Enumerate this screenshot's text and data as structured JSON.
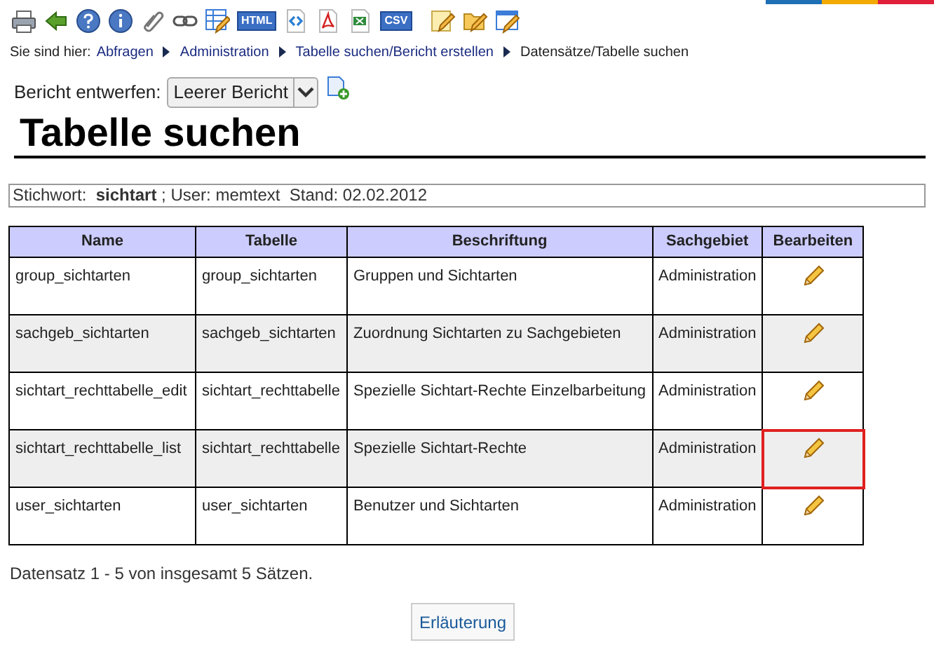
{
  "toolbar": [
    {
      "kind": "printer"
    },
    {
      "kind": "back"
    },
    {
      "kind": "help"
    },
    {
      "kind": "info"
    },
    {
      "kind": "clip"
    },
    {
      "kind": "link"
    },
    {
      "kind": "table-edit"
    },
    {
      "kind": "badge",
      "label": "HTML"
    },
    {
      "kind": "code"
    },
    {
      "kind": "pdf"
    },
    {
      "kind": "excel"
    },
    {
      "kind": "badge",
      "label": "CSV"
    },
    {
      "kind": "note-edit"
    },
    {
      "kind": "folder-edit"
    },
    {
      "kind": "window-edit"
    }
  ],
  "breadcrumb": {
    "label": "Sie sind hier:",
    "links": [
      "Abfragen",
      "Administration",
      "Tabelle suchen/Bericht erstellen"
    ],
    "current": "Datensätze/Tabelle suchen"
  },
  "report": {
    "label": "Bericht entwerfen:",
    "value": "Leerer Bericht"
  },
  "title": "Tabelle suchen",
  "info": "Stichwort:  **sichtart** ; User: memtext  Stand: 02.02.2012",
  "table": {
    "columns": [
      "Name",
      "Tabelle",
      "Beschriftung",
      "Sachgebiet",
      "Bearbeiten"
    ],
    "rows": [
      {
        "cells": [
          "group_sichtarten",
          "group_sichtarten",
          "Gruppen und Sichtarten",
          "Administration"
        ],
        "highlighted": false
      },
      {
        "cells": [
          "sachgeb_sichtarten",
          "sachgeb_sichtarten",
          "Zuordnung Sichtarten zu Sachgebieten",
          "Administration"
        ],
        "highlighted": false
      },
      {
        "cells": [
          "sichtart_rechttabelle_edit",
          "sichtart_rechttabelle",
          "Spezielle Sichtart-Rechte Einzelbarbeitung",
          "Administration"
        ],
        "highlighted": false
      },
      {
        "cells": [
          "sichtart_rechttabelle_list",
          "sichtart_rechttabelle",
          "Spezielle Sichtart-Rechte",
          "Administration"
        ],
        "highlighted": true
      },
      {
        "cells": [
          "user_sichtarten",
          "user_sichtarten",
          "Benutzer und Sichtarten",
          "Administration"
        ],
        "highlighted": false
      }
    ]
  },
  "summary": "Datensatz 1 - 5 von insgesamt 5 Sätzen.",
  "button": "Erläuterung"
}
